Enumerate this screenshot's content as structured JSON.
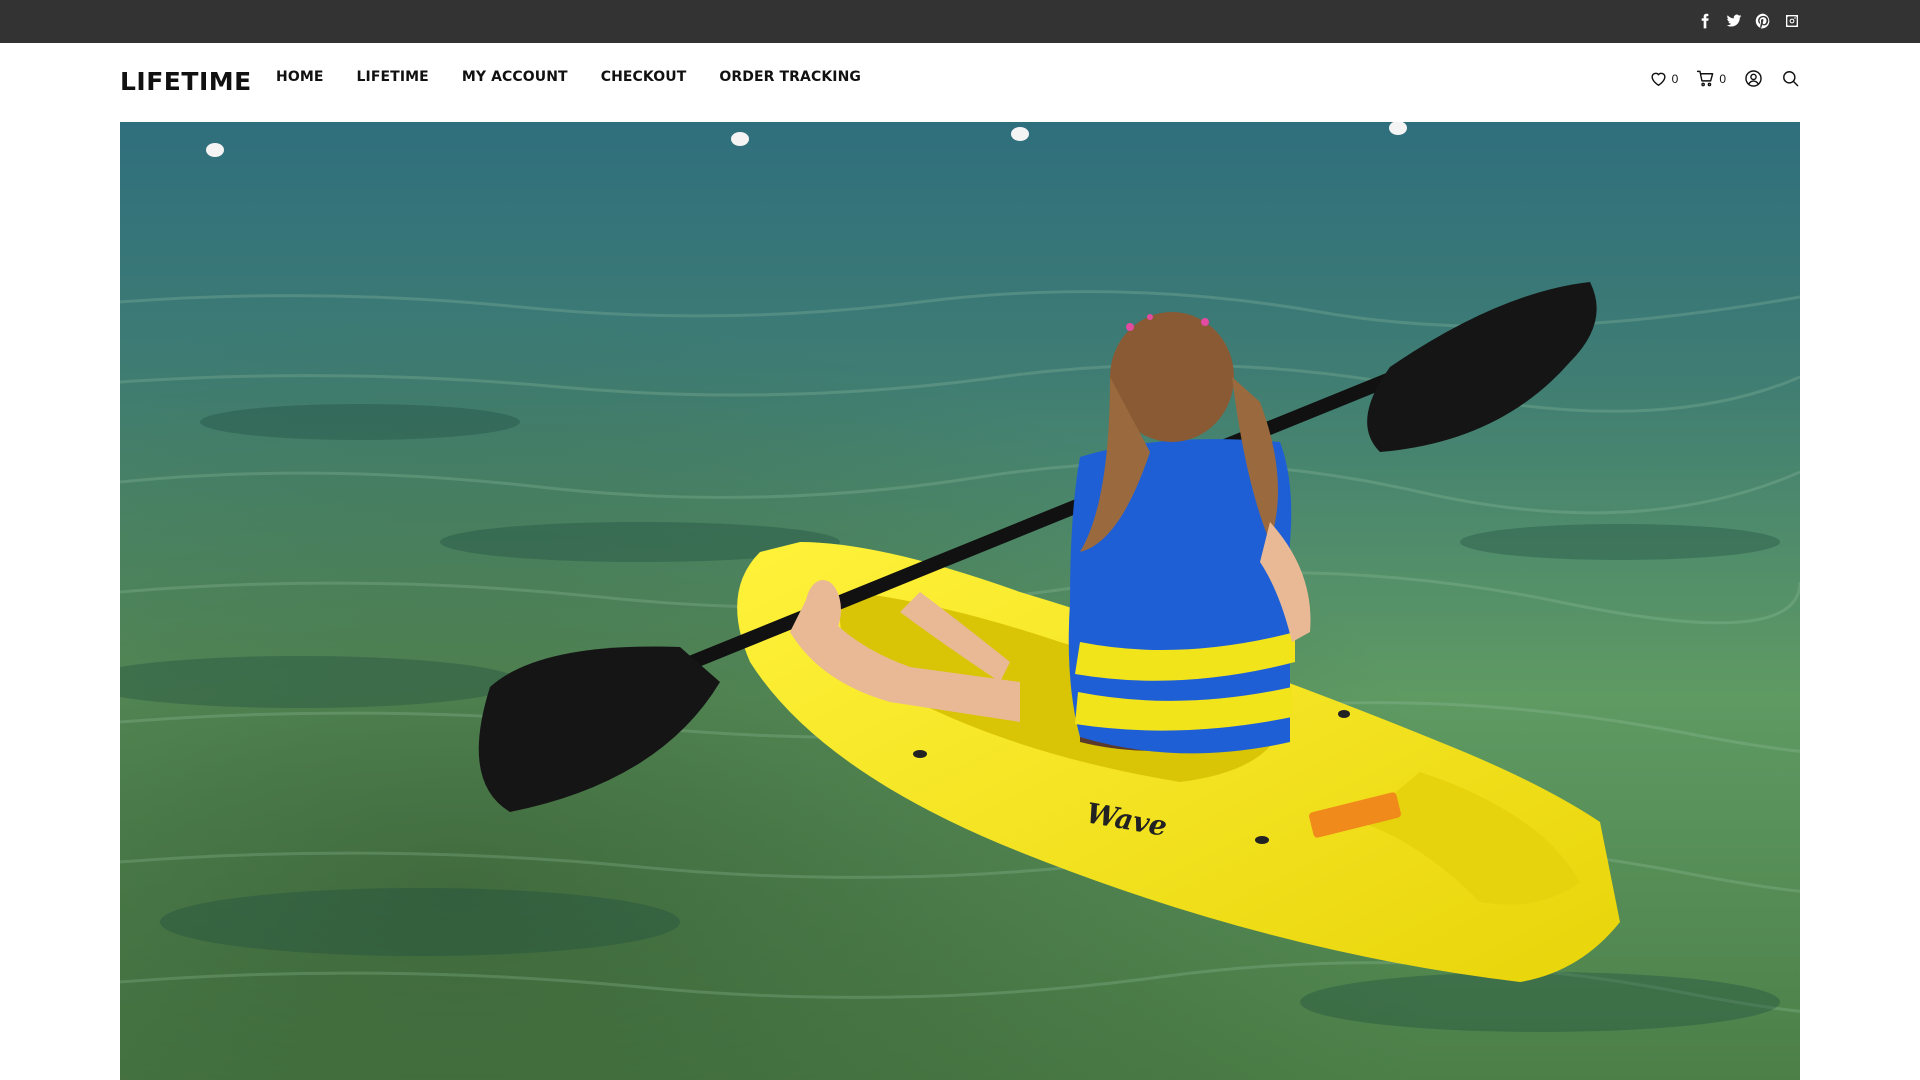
{
  "site": {
    "logo": "LIFETIME"
  },
  "nav": {
    "items": [
      {
        "label": "HOME"
      },
      {
        "label": "LIFETIME"
      },
      {
        "label": "MY ACCOUNT"
      },
      {
        "label": "CHECKOUT"
      },
      {
        "label": "ORDER TRACKING"
      }
    ]
  },
  "social": [
    "facebook-icon",
    "twitter-icon",
    "pinterest-icon",
    "instagram-icon"
  ],
  "tools": {
    "wishlist_count": "0",
    "cart_count": "0"
  },
  "hero": {
    "kayak_text": "Wave"
  },
  "colors": {
    "topbar": "#333333",
    "text": "#111111",
    "kayak": "#f5e61a",
    "vest": "#1f5fd6"
  }
}
